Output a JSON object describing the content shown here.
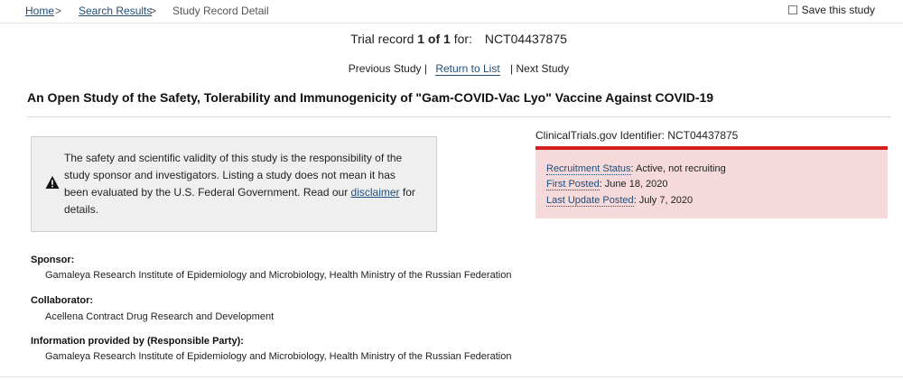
{
  "breadcrumb": {
    "home": "Home",
    "search_results": "Search Results",
    "current": "Study Record Detail",
    "separator": ">"
  },
  "save": {
    "label": "Save this study",
    "checked": false
  },
  "record": {
    "prefix": "Trial record",
    "position": "1 of 1",
    "for_label": "for:",
    "nct_id": "NCT04437875"
  },
  "nav": {
    "previous": "Previous Study |",
    "return": "Return to List",
    "next": "| Next Study"
  },
  "study_title": "An Open Study of the Safety, Tolerability and Immunogenicity of \"Gam-COVID-Vac Lyo\" Vaccine Against COVID-19",
  "disclaimer": {
    "text_before": "The safety and scientific validity of this study is the responsibility of the study sponsor and investigators. Listing a study does not mean it has been evaluated by the U.S. Federal Government. Read our ",
    "link": "disclaimer",
    "text_after": " for details.",
    "icon": "warning-icon"
  },
  "identifier": {
    "label": "ClinicalTrials.gov Identifier:",
    "value": "NCT04437875"
  },
  "status": {
    "recruitment_label": "Recruitment Status",
    "recruitment_value": ": Active, not recruiting",
    "first_posted_label": "First Posted",
    "first_posted_value": ": June 18, 2020",
    "last_update_label": "Last Update Posted",
    "last_update_value": ": July 7, 2020"
  },
  "fields": {
    "sponsor_label": "Sponsor:",
    "sponsor_value": "Gamaleya Research Institute of Epidemiology and Microbiology, Health Ministry of the Russian Federation",
    "collaborator_label": "Collaborator:",
    "collaborator_value": "Acellena Contract Drug Research and Development",
    "info_label": "Information provided by (Responsible Party):",
    "info_value": "Gamaleya Research Institute of Epidemiology and Microbiology, Health Ministry of the Russian Federation"
  },
  "colors": {
    "link": "#1f4e79",
    "status_bg": "#f6d9da",
    "status_rule": "#d62020",
    "disclaimer_bg": "#efefef"
  }
}
